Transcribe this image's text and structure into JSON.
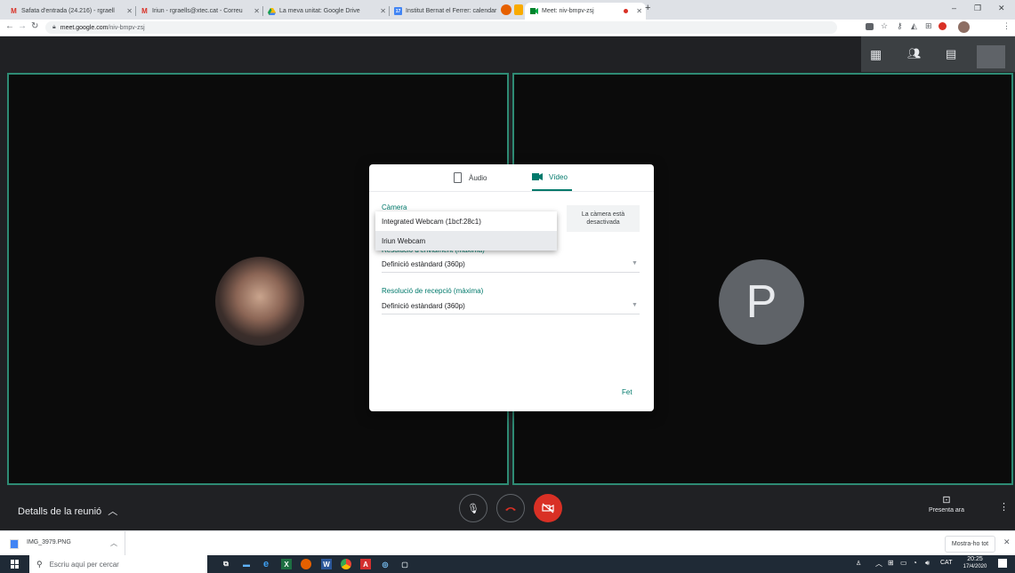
{
  "browser": {
    "tabs": [
      {
        "label": "Safata d'entrada (24.216) - rgraell",
        "icon": "gmail-icon"
      },
      {
        "label": "Iriun - rgraells@xtec.cat - Correu",
        "icon": "gmail-icon"
      },
      {
        "label": "La meva unitat: Google Drive",
        "icon": "drive-icon"
      },
      {
        "label": "Institut Bernat el Ferrer: calendar",
        "icon": "calendar-icon"
      },
      {
        "label": "Meet: niv-bmpv-zsj",
        "icon": "meet-icon",
        "active": true
      }
    ],
    "url_domain": "meet.google.com",
    "url_path": "/niv-bmpv-zsj"
  },
  "meet": {
    "participant_initial": "P",
    "meeting_details_label": "Detalls de la reunió",
    "present_now_label": "Presenta ara"
  },
  "dialog": {
    "tab_audio": "Àudio",
    "tab_video": "Vídeo",
    "camera_label": "Càmera",
    "camera_options": [
      "Integrated Webcam (1bcf:28c1)",
      "Iriun Webcam"
    ],
    "camera_off_text": "La càmera està desactivada",
    "send_resolution_label": "Resolució d'enviament (màxima)",
    "send_resolution_value": "Definició estàndard (360p)",
    "receive_resolution_label": "Resolució de recepció (màxima)",
    "receive_resolution_value": "Definició estàndard (360p)",
    "done_label": "Fet"
  },
  "download_bar": {
    "file_name": "IMG_3979.PNG",
    "show_all_label": "Mostra-ho tot"
  },
  "taskbar": {
    "search_placeholder": "Escriu aquí per cercar",
    "language": "CAT",
    "time": "20:25",
    "date": "17/4/2020"
  },
  "colors": {
    "accent_teal": "#00796b",
    "end_call_red": "#d93025",
    "tile_border": "#2e8b74"
  }
}
